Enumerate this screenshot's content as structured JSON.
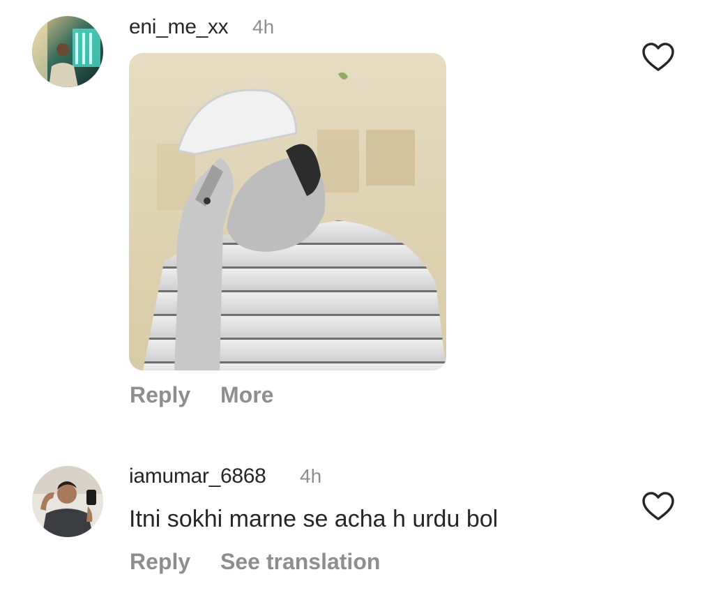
{
  "comments": [
    {
      "username": "eni_me_xx",
      "time": "4h",
      "avatar_icon": "user-avatar-icon",
      "media": "facepalm-gif",
      "actions": {
        "reply": "Reply",
        "more": "More"
      }
    },
    {
      "username": "iamumar_6868",
      "time": "4h",
      "avatar_icon": "user-avatar-icon",
      "text": "Itni sokhi marne se acha h urdu bol",
      "actions": {
        "reply": "Reply",
        "translate": "See translation"
      }
    }
  ],
  "colors": {
    "text_primary": "#262626",
    "text_secondary": "#8e8e8e",
    "background": "#ffffff"
  }
}
